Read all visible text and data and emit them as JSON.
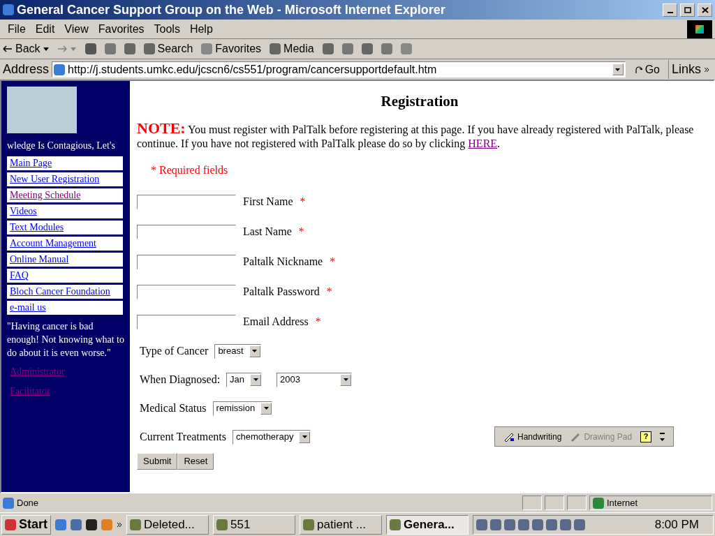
{
  "window": {
    "title": "General Cancer Support Group on the Web - Microsoft Internet Explorer"
  },
  "menu": [
    "File",
    "Edit",
    "View",
    "Favorites",
    "Tools",
    "Help"
  ],
  "toolbar": {
    "back": "Back",
    "search": "Search",
    "favorites": "Favorites",
    "media": "Media"
  },
  "address": {
    "label": "Address",
    "url": "http://j.students.umkc.edu/jcscn6/cs551/program/cancersupportdefault.htm",
    "go": "Go",
    "links": "Links"
  },
  "sidebar": {
    "marquee": "wledge Is Contagious, Let's",
    "items": [
      {
        "label": "Main Page",
        "visited": false
      },
      {
        "label": "New User Registration",
        "visited": false
      },
      {
        "label": "Meeting Schedule",
        "visited": true
      },
      {
        "label": "Videos",
        "visited": false
      },
      {
        "label": "Text Modules",
        "visited": false
      },
      {
        "label": "Account Management",
        "visited": false
      },
      {
        "label": "Online Manual",
        "visited": false
      },
      {
        "label": "FAQ",
        "visited": false
      },
      {
        "label": "Bloch Cancer Foundation",
        "visited": false
      },
      {
        "label": "e-mail us",
        "visited": false
      }
    ],
    "quote": "\"Having cancer is bad enough! Not knowing what to do about it is even worse.\"",
    "links": [
      {
        "label": "Administrator",
        "visited": true
      },
      {
        "label": "Facilitator",
        "visited": true
      }
    ]
  },
  "page": {
    "heading": "Registration",
    "note_label": "NOTE:",
    "note": "You must register with PalTalk before registering at this page.  If you have already registered with PalTalk, please continue. If you have not registered with PalTalk please do so by clicking",
    "note_link": "HERE",
    "note_end": ".",
    "required_note": "* Required fields",
    "fields": [
      {
        "label": "First Name",
        "required_mark": "*"
      },
      {
        "label": "Last Name",
        "required_mark": "*"
      },
      {
        "label": "Paltalk Nickname",
        "required_mark": "*"
      },
      {
        "label": "Paltalk Password",
        "required_mark": "*"
      },
      {
        "label": "Email Address",
        "required_mark": "*"
      }
    ],
    "selects": [
      {
        "label": "Type of Cancer",
        "values": [
          "breast"
        ]
      },
      {
        "label": "When Diagnosed:",
        "values": [
          "Jan",
          "2003"
        ]
      },
      {
        "label": "Medical Status",
        "values": [
          "remission"
        ]
      },
      {
        "label": "Current Treatments",
        "values": [
          "chemotherapy"
        ]
      }
    ],
    "buttons": [
      "Submit",
      "Reset"
    ]
  },
  "handwriting_bar": {
    "handwriting": "Handwriting",
    "drawing_pad": "Drawing Pad",
    "drawing_pad_disabled": true,
    "help": "?"
  },
  "status_bar": {
    "text": "Done",
    "zone": "Internet"
  },
  "taskbar": {
    "start": "Start",
    "tasks": [
      {
        "label": "Deleted...",
        "selected": false
      },
      {
        "label": "551",
        "selected": false
      },
      {
        "label": "patient ...",
        "selected": false
      },
      {
        "label": "Genera...",
        "selected": true
      }
    ],
    "clock": "8:00 PM"
  }
}
